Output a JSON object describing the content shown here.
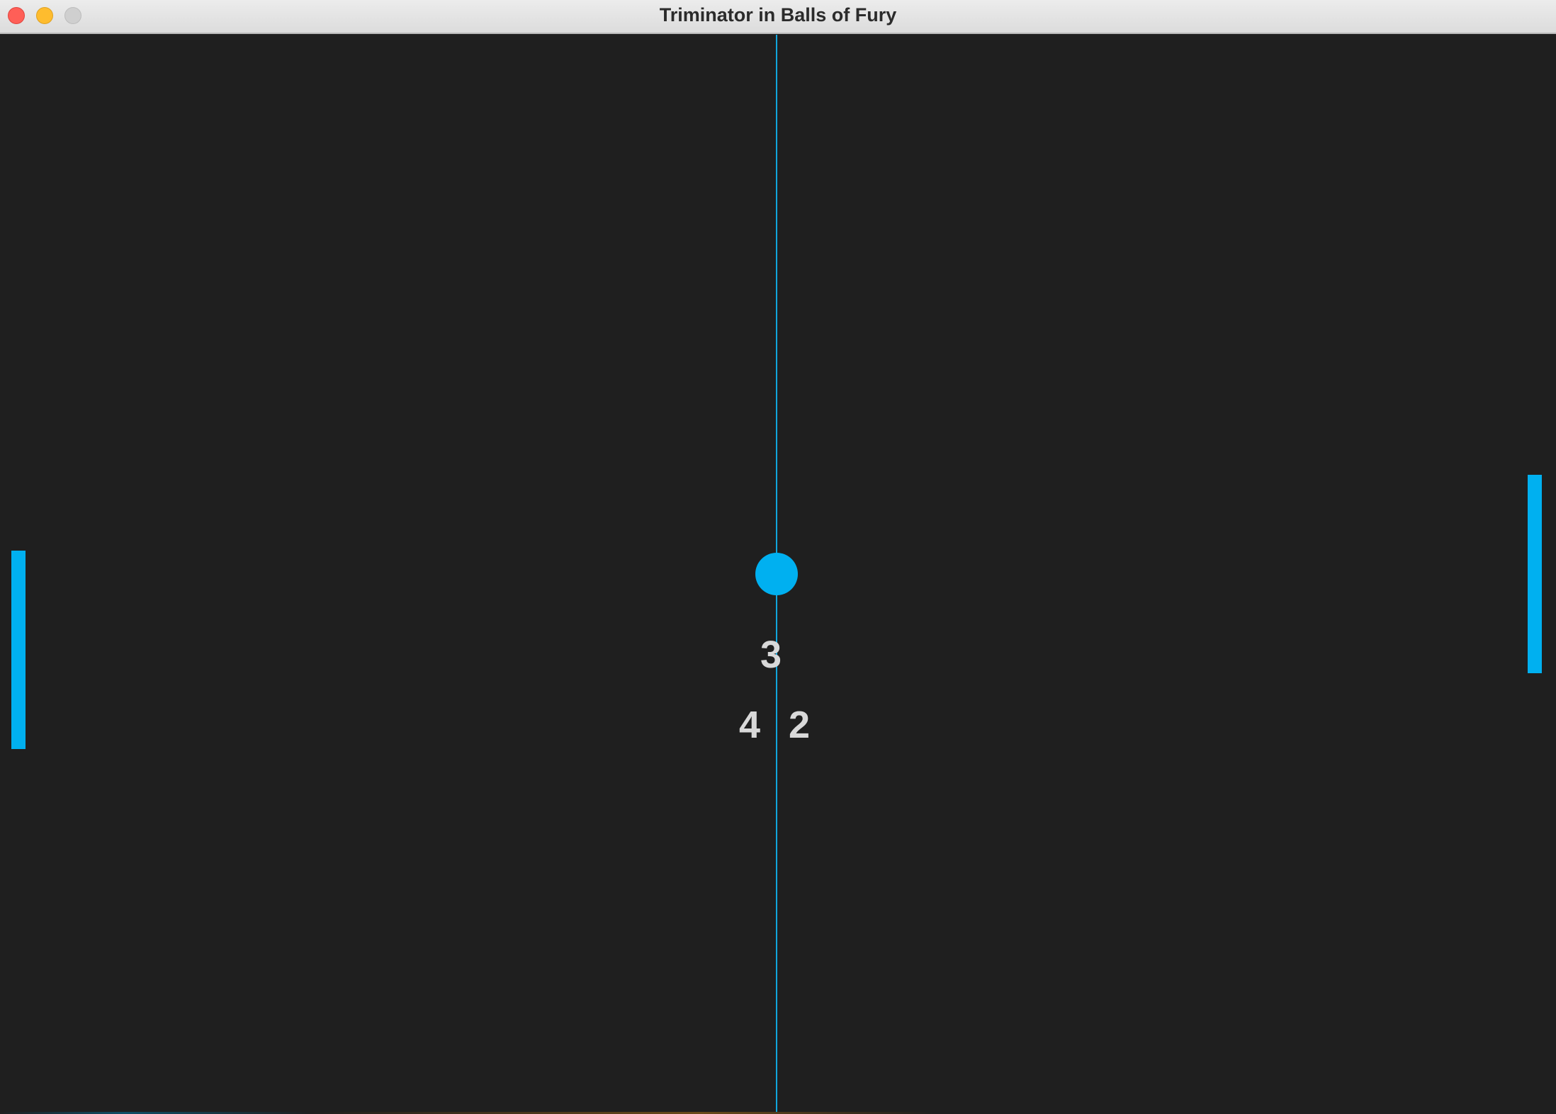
{
  "window": {
    "title": "Triminator in Balls of Fury"
  },
  "game": {
    "rally_count": "3",
    "score": {
      "left": "4",
      "right": "2"
    }
  },
  "colors": {
    "background": "#1f1f1f",
    "paddle": "#00b0f0",
    "ball": "#00b0f0",
    "net": "#11a6dd",
    "score_text": "#d9d9d9"
  },
  "icons": {
    "close": "close-dot-icon",
    "minimize": "minimize-dot-icon",
    "zoom": "zoom-dot-icon"
  }
}
